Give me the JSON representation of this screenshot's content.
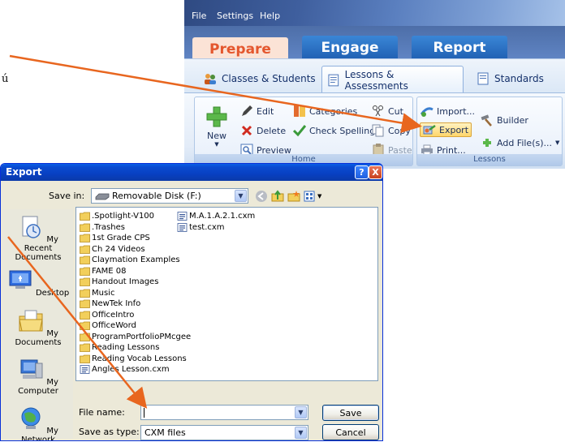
{
  "stray_glyph": "ú",
  "menu": [
    "File",
    "Settings",
    "Help"
  ],
  "top_tabs": [
    "Prepare",
    "Engage",
    "Report"
  ],
  "sub_tabs": [
    "Classes & Students",
    "Lessons & Assessments",
    "Standards"
  ],
  "ribbon": {
    "new_label": "New",
    "edit": "Edit",
    "delete": "Delete",
    "preview": "Preview",
    "categories": "Categories",
    "check_spelling": "Check Spelling",
    "cut": "Cut",
    "copy": "Copy",
    "paste": "Paste",
    "home_group": "Home",
    "import": "Import...",
    "export": "Export",
    "print": "Print...",
    "builder": "Builder",
    "add_files": "Add File(s)...",
    "lessons_group": "Lessons"
  },
  "dialog": {
    "title": "Export",
    "help_btn": "?",
    "close_btn": "X",
    "save_in_label": "Save in:",
    "save_in_value": "Removable Disk (F:)",
    "places": [
      "My Recent Documents",
      "Desktop",
      "My Documents",
      "My Computer",
      "My Network"
    ],
    "files_col1": [
      ".Spotlight-V100",
      ".Trashes",
      "1st Grade CPS",
      "Ch 24 Videos",
      "Claymation Examples",
      "FAME 08",
      "Handout Images",
      "Music",
      "NewTek Info",
      "OfficeIntro",
      "OfficeWord",
      "ProgramPortfolioPMcgee",
      "Reading Lessons",
      "Reading Vocab Lessons",
      "Angles Lesson.cxm"
    ],
    "files_col2": [
      "M.A.1.A.2.1.cxm",
      "test.cxm"
    ],
    "file_name_label": "File name:",
    "file_name_value": "",
    "save_type_label": "Save as type:",
    "save_type_value": "CXM files",
    "save_btn": "Save",
    "cancel_btn": "Cancel"
  },
  "colors": {
    "arrow": "#e8661f",
    "xp_title": "#0a4bd0",
    "prepare_tab_text": "#e4572e"
  }
}
